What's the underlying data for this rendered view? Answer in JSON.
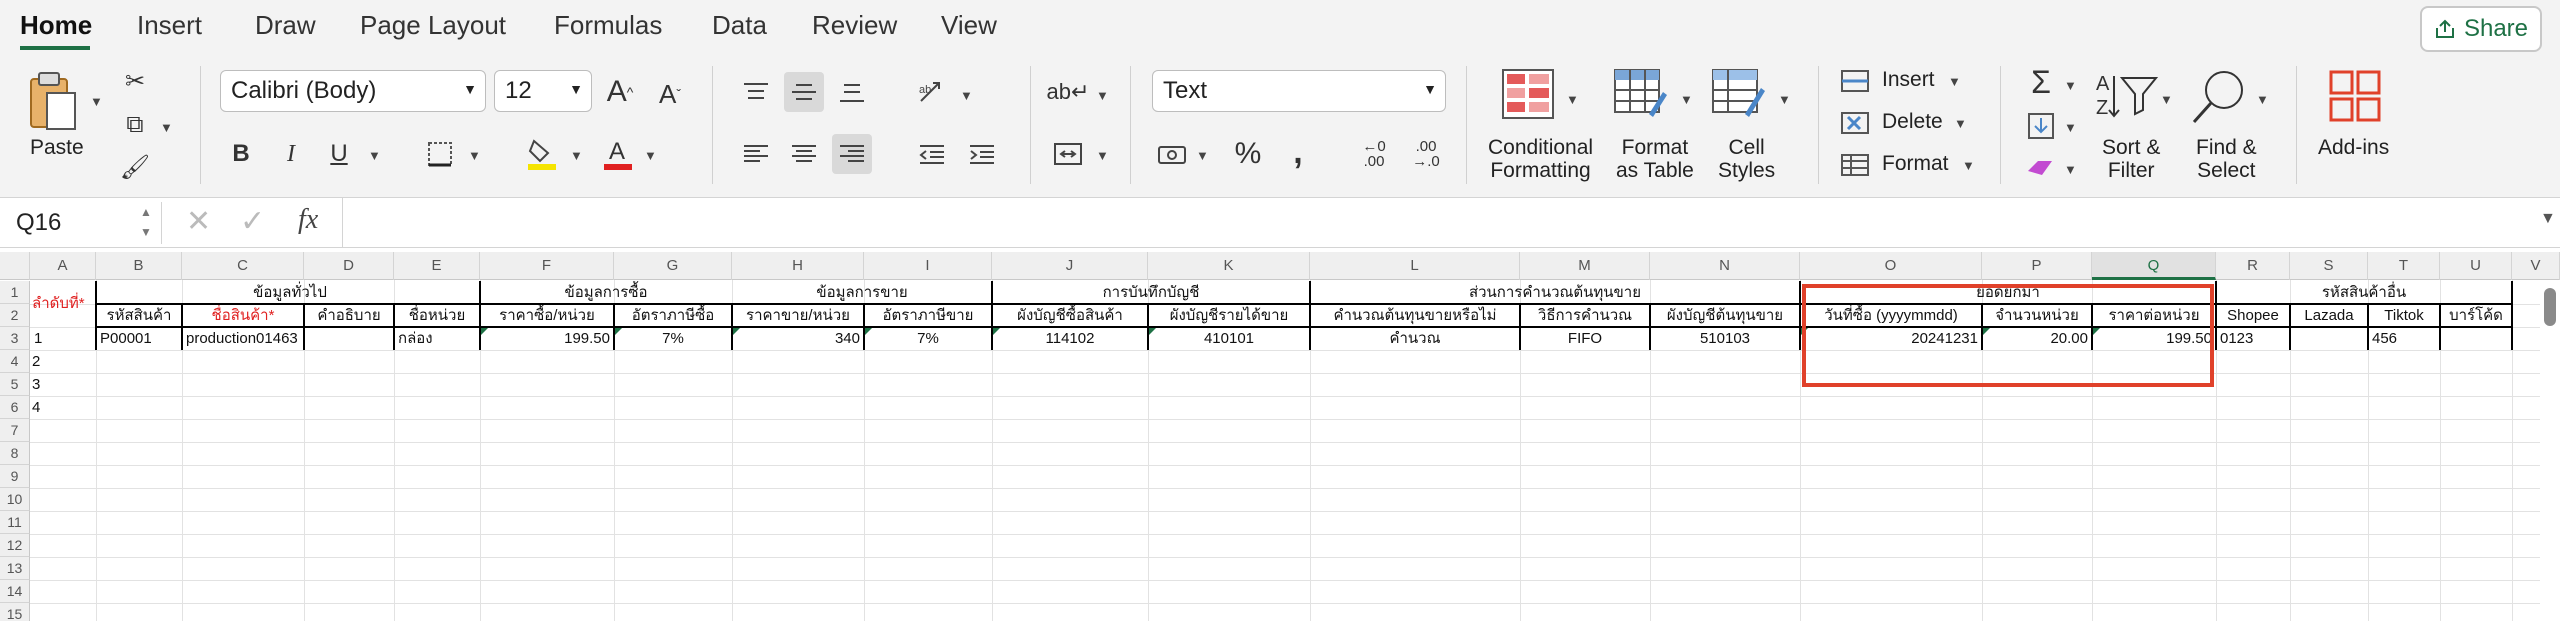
{
  "tabs": [
    "Home",
    "Insert",
    "Draw",
    "Page Layout",
    "Formulas",
    "Data",
    "Review",
    "View"
  ],
  "share": {
    "label": "Share"
  },
  "ribbon": {
    "paste": "Paste",
    "font_name": "Calibri (Body)",
    "font_size": "12",
    "number_format": "Text",
    "conditional_formatting": [
      "Conditional",
      "Formatting"
    ],
    "format_as_table": [
      "Format",
      "as Table"
    ],
    "cell_styles": [
      "Cell",
      "Styles"
    ],
    "insert": "Insert",
    "delete": "Delete",
    "format": "Format",
    "sort_filter": [
      "Sort &",
      "Filter"
    ],
    "find_select": [
      "Find &",
      "Select"
    ],
    "addins": "Add-ins"
  },
  "formula_bar": {
    "name_box": "Q16",
    "fx": "fx",
    "content": ""
  },
  "columns": [
    "A",
    "B",
    "C",
    "D",
    "E",
    "F",
    "G",
    "H",
    "I",
    "J",
    "K",
    "L",
    "M",
    "N",
    "O",
    "P",
    "Q",
    "R",
    "S",
    "T",
    "U",
    "V"
  ],
  "rows": [
    "1",
    "2",
    "3",
    "4",
    "5",
    "6",
    "7",
    "8",
    "9",
    "10",
    "11",
    "12",
    "13",
    "14",
    "15"
  ],
  "sheet": {
    "a1": "ลำดับที่*",
    "groups": {
      "general": "ข้อมูลทั่วไป",
      "purchase": "ข้อมูลการซื้อ",
      "sales": "ข้อมูลการขาย",
      "accounting": "การบันทึกบัญชี",
      "cost": "ส่วนการคำนวณต้นทุนขาย",
      "opening": "ยอดยกมา",
      "other_codes": "รหัสสินค้าอื่น"
    },
    "headers": {
      "B": "รหัสสินค้า",
      "C": "ชื่อสินค้า*",
      "D": "คำอธิบาย",
      "E": "ชื่อหน่วย",
      "F": "ราคาซื้อ/หน่วย",
      "G": "อัตราภาษีซื้อ",
      "H": "ราคาขาย/หน่วย",
      "I": "อัตราภาษีขาย",
      "J": "ผังบัญชีซื้อสินค้า",
      "K": "ผังบัญชีรายได้ขาย",
      "L": "คำนวณต้นทุนขายหรือไม่",
      "M": "วิธีการคำนวณ",
      "N": "ผังบัญชีต้นทุนขาย",
      "O": "วันที่ซื้อ (yyyymmdd)",
      "P": "จำนวนหน่วย",
      "Q": "ราคาต่อหน่วย",
      "R": "Shopee",
      "S": "Lazada",
      "T": "Tiktok",
      "U": "บาร์โค้ด"
    },
    "row3": {
      "A": "1",
      "B": "P00001",
      "C": "production01463",
      "E": "กล่อง",
      "F": "199.50",
      "G": "7%",
      "H": "340",
      "I": "7%",
      "J": "114102",
      "K": "410101",
      "L": "คำนวณ",
      "M": "FIFO",
      "N": "510103",
      "O": "20241231",
      "P": "20.00",
      "Q": "199.50",
      "R": "0123",
      "T": "456"
    },
    "col_a": {
      "r4": "2",
      "r5": "3",
      "r6": "4"
    }
  },
  "colors": {
    "accent": "#1e7145",
    "highlight": "#e0412a",
    "required": "#e02020"
  }
}
